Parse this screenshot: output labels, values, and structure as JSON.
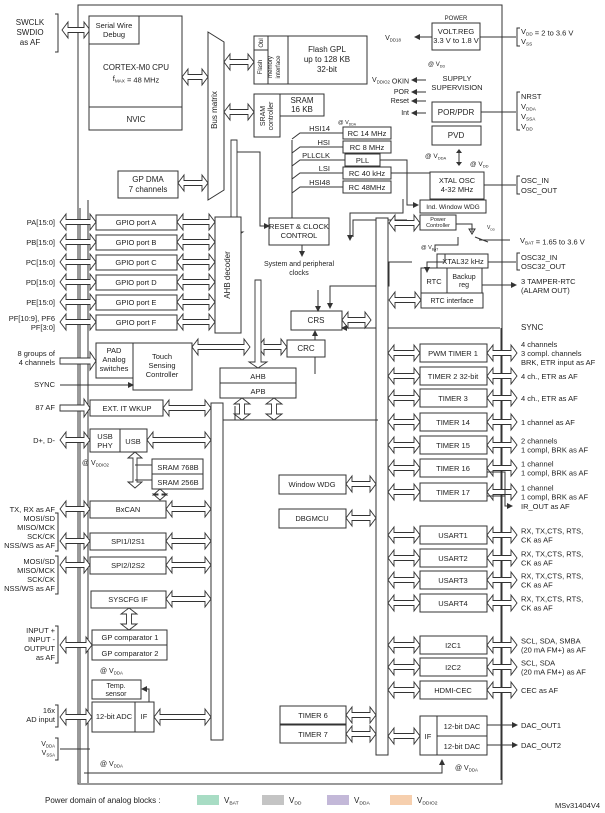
{
  "colors": {
    "vbat": "#a8dcc4",
    "vdd": "#c4c4c4",
    "vdda": "#c3b8d8",
    "vddio2": "#f6cfae",
    "stroke": "#333333"
  },
  "cpu": {
    "swd_signals": [
      "SWCLK",
      "SWDIO",
      "as AF"
    ],
    "debug": [
      "Serial Wire",
      "Debug"
    ],
    "core": "CORTEX-M0 CPU",
    "fmax": "f",
    "fmax_sub": "MAX",
    "fmax_val": " = 48 MHz",
    "nvic": "NVIC"
  },
  "bus_matrix": "Bus matrix",
  "flash": {
    "obl": "Obl",
    "iface": [
      "Flash",
      "memory",
      "interface"
    ],
    "main": [
      "Flash GPL",
      "up to 128 KB",
      "32-bit"
    ]
  },
  "sram": {
    "ctrl": [
      "SRAM",
      "controller"
    ],
    "main": [
      "SRAM",
      "16 KB"
    ]
  },
  "dma": [
    "GP DMA",
    "7 channels"
  ],
  "power": {
    "title": "POWER",
    "reg": [
      "VOLT.REG",
      "3.3 V to 1.8 V"
    ],
    "out": "V",
    "out_sub": "DD18",
    "at_vdd": "@ V",
    "at_vdd_sub": "DD",
    "supply_label": [
      "V",
      "DD",
      " = 2 to 3.6 V"
    ],
    "vss": [
      "V",
      "SS"
    ]
  },
  "supervision": {
    "title": [
      "SUPPLY",
      "SUPERVISION"
    ],
    "signals": [
      {
        "text": "V",
        "sub": "DDIO2",
        "after": " OKIN"
      },
      {
        "text": "POR",
        "sub": "",
        "after": ""
      },
      {
        "text": "Reset",
        "sub": "",
        "after": ""
      },
      {
        "text": "Int",
        "sub": "",
        "after": ""
      }
    ],
    "por": "POR/PDR",
    "pvd": "PVD",
    "pins": [
      {
        "t": "NRST",
        "s": ""
      },
      {
        "t": "V",
        "s": "DDA"
      },
      {
        "t": "V",
        "s": "SSA"
      },
      {
        "t": "V",
        "s": "DD"
      }
    ],
    "at_vdda": "@ V",
    "at_vdda_sub": "DDA",
    "at_vdd": "@ V",
    "at_vdd_sub": "DD"
  },
  "clocks": {
    "at": "@ V",
    "at_sub": "DDA",
    "labels": [
      "HSI14",
      "HSI",
      "PLLCLK",
      "LSI",
      "HSI48"
    ],
    "boxes": [
      "RC 14 MHz",
      "RC 8 MHz",
      "PLL",
      "RC 40 kHz",
      "RC 48MHz"
    ]
  },
  "xtal": {
    "main": [
      "XTAL OSC",
      "4-32 MHz"
    ],
    "iwdg": "Ind. Window WDG",
    "pins": [
      "OSC_IN",
      "OSC_OUT"
    ]
  },
  "pwr_ctrl": {
    "box": [
      "Power",
      "Controller"
    ],
    "vdd": "V",
    "vdd_sub": "DD",
    "vbat": "V",
    "vbat_sub": "BAT",
    "vbat_range": " = 1.65 to 3.6 V",
    "at": "@ V",
    "at_sub": "BAT"
  },
  "rtc": {
    "xtal": "XTAL32 kHz",
    "rtc": "RTC",
    "backup": [
      "Backup",
      "reg"
    ],
    "iface": "RTC interface",
    "pins": [
      "OSC32_IN",
      "OSC32_OUT"
    ],
    "tamper": [
      "3 TAMPER-RTC",
      "(ALARM OUT)"
    ]
  },
  "reset_clock": {
    "box": [
      "RESET & CLOCK",
      "CONTROL"
    ],
    "sub": [
      "System and peripheral",
      "clocks"
    ]
  },
  "crs": "CRS",
  "crc": "CRC",
  "sync": "SYNC",
  "ahb_decoder": "AHB decoder",
  "gpio": [
    {
      "pins": [
        "PA[15:0]"
      ],
      "label": "GPIO port A"
    },
    {
      "pins": [
        "PB[15:0]"
      ],
      "label": "GPIO port B"
    },
    {
      "pins": [
        "PC[15:0]"
      ],
      "label": "GPIO port C"
    },
    {
      "pins": [
        "PD[15:0]"
      ],
      "label": "GPIO port D"
    },
    {
      "pins": [
        "PE[15:0]"
      ],
      "label": "GPIO port E"
    },
    {
      "pins": [
        "PF[10:9], PF6",
        "PF[3:0]"
      ],
      "label": "GPIO port F"
    }
  ],
  "touch": {
    "groups": [
      "8 groups of",
      "4 channels"
    ],
    "pad": [
      "PAD",
      "Analog",
      "switches"
    ],
    "ctrl": [
      "Touch",
      "Sensing",
      "Controller"
    ],
    "sync": "SYNC"
  },
  "ahb": "AHB",
  "apb": "APB",
  "exti": {
    "pins": "87 AF",
    "label": "EXT. IT  WKUP"
  },
  "usb": {
    "pins": "D+, D-",
    "phy": [
      "USB",
      "PHY"
    ],
    "usb": "USB",
    "at": "@ V",
    "at_sub": "DDIO2",
    "sram1": "SRAM 768B",
    "sram2": "SRAM 256B"
  },
  "left_periph": [
    {
      "pins": [
        "TX, RX as AF"
      ],
      "label": "BxCAN"
    },
    {
      "pins": [
        "MOSI/SD",
        "MISO/MCK",
        "SCK/CK",
        "NSS/WS as AF"
      ],
      "label": "SPI1/I2S1"
    },
    {
      "pins": [
        "MOSI/SD",
        "MISO/MCK",
        "SCK/CK",
        "NSS/WS as AF"
      ],
      "label": "SPI2/I2S2"
    }
  ],
  "syscfg": "SYSCFG IF",
  "comp": {
    "pins": [
      "INPUT +",
      "INPUT -",
      "OUTPUT",
      "as AF"
    ],
    "c1": "GP comparator 1",
    "c2": "GP comparator 2",
    "at": "@ V",
    "at_sub": "DDA"
  },
  "adc": {
    "temp": [
      "Temp.",
      "sensor"
    ],
    "adc": "12-bit ADC",
    "if": "IF",
    "pins": [
      "16x",
      "AD input"
    ],
    "supply": [
      {
        "t": "V",
        "s": "DDA"
      },
      {
        "t": "V",
        "s": "SSA"
      }
    ],
    "at": "@ V",
    "at_sub": "DDA"
  },
  "mid_blocks": {
    "wwdg": "Window WDG",
    "dbg": "DBGMCU",
    "tim6": "TIMER 6",
    "tim7": "TIMER 7"
  },
  "right_periph": [
    {
      "label": "PWM TIMER 1",
      "pins": [
        "4 channels",
        "3 compl. channels",
        "BRK, ETR input as AF"
      ]
    },
    {
      "label": "TIMER 2 32-bit",
      "pins": [
        "4 ch., ETR as AF"
      ]
    },
    {
      "label": "TIMER 3",
      "pins": [
        "4 ch., ETR as AF"
      ]
    },
    {
      "label": "TIMER 14",
      "pins": [
        "1 channel as AF"
      ]
    },
    {
      "label": "TIMER 15",
      "pins": [
        "2 channels",
        "1 compl, BRK as AF"
      ]
    },
    {
      "label": "TIMER 16",
      "pins": [
        "1 channel",
        "1 compl, BRK as AF"
      ]
    },
    {
      "label": "TIMER 17",
      "pins": [
        "1 channel",
        "1 compl, BRK as AF"
      ]
    },
    {
      "label": "USART1",
      "pins": [
        "RX, TX,CTS, RTS,",
        "CK as AF"
      ]
    },
    {
      "label": "USART2",
      "pins": [
        "RX, TX,CTS, RTS,",
        "CK as AF"
      ]
    },
    {
      "label": "USART3",
      "pins": [
        "RX, TX,CTS, RTS,",
        "CK as AF"
      ]
    },
    {
      "label": "USART4",
      "pins": [
        "RX, TX,CTS, RTS,",
        "CK as AF"
      ]
    },
    {
      "label": "I2C1",
      "pins": [
        "SCL, SDA, SMBA",
        "(20 mA FM+) as AF"
      ]
    },
    {
      "label": "I2C2",
      "pins": [
        "SCL, SDA",
        "(20 mA FM+) as AF"
      ]
    },
    {
      "label": "HDMI-CEC",
      "pins": [
        "CEC as AF"
      ]
    }
  ],
  "ir_out": "IR_OUT as AF",
  "dac": {
    "if": "IF",
    "d1": "12-bit  DAC",
    "d2": "12-bit DAC",
    "o1": "DAC_OUT1",
    "o2": "DAC_OUT2",
    "at": "@ V",
    "at_sub": "DDA"
  },
  "legend": {
    "title": "Power domain of analog blocks :",
    "items": [
      {
        "t": "V",
        "s": "BAT",
        "key": "vbat"
      },
      {
        "t": "V",
        "s": "DD",
        "key": "vdd"
      },
      {
        "t": "V",
        "s": "DDA",
        "key": "vdda"
      },
      {
        "t": "V",
        "s": "DDIO2",
        "key": "vddio2"
      }
    ]
  },
  "figure_id": "MSv31404V4"
}
